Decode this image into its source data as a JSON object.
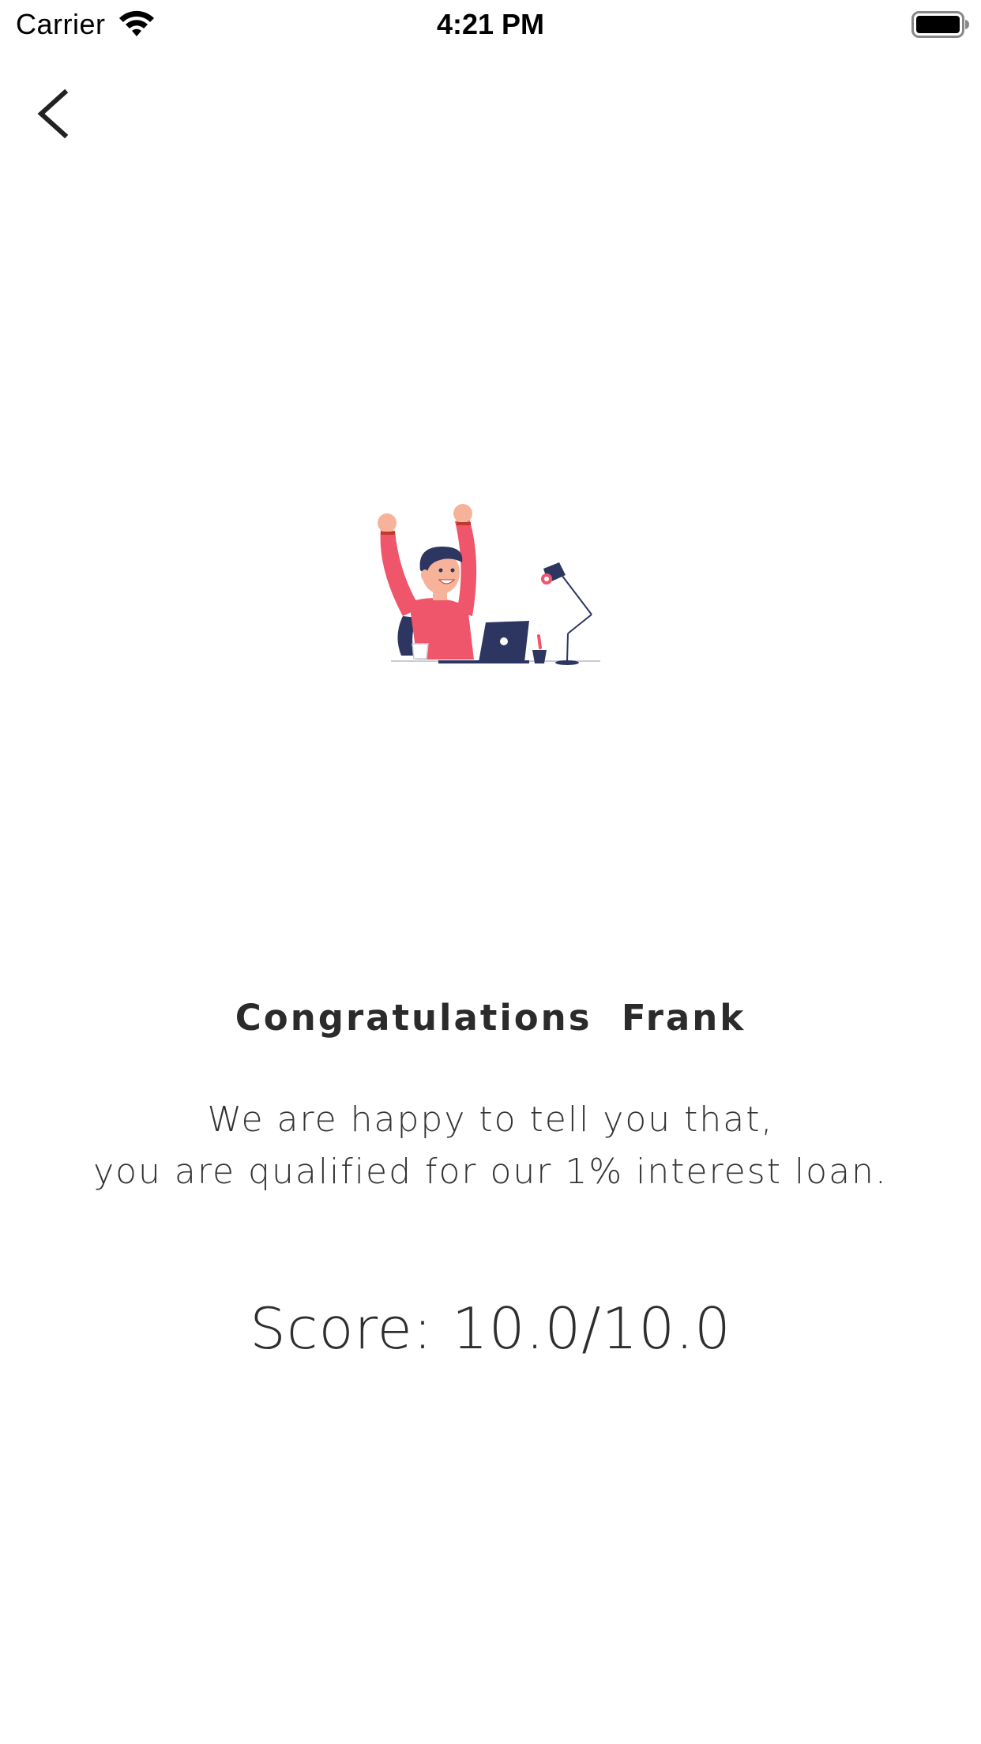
{
  "status_bar": {
    "carrier": "Carrier",
    "time": "4:21 PM",
    "wifi_icon": "wifi-icon",
    "battery_icon": "battery-icon"
  },
  "nav": {
    "back_icon": "chevron-left-icon"
  },
  "illustration": {
    "icon": "celebrating-person-at-desk-illustration",
    "colors": {
      "sweater": "#f0566b",
      "navy": "#2d3561",
      "skin": "#f7b39a",
      "hair": "#2d3561"
    }
  },
  "content": {
    "title": "Congratulations  Frank",
    "message_line1": "We are happy to tell you that,",
    "message_line2": "you are qualified for our 1% interest loan.",
    "score": "Score: 10.0/10.0"
  }
}
